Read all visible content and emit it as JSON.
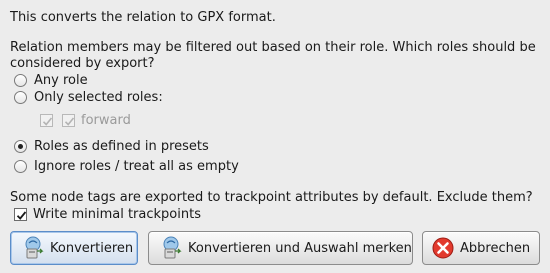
{
  "intro": "This converts the relation to GPX format.",
  "roles_question_line1": "Relation members may be filtered out based on their role. Which roles should be",
  "roles_question_line2": "considered by export?",
  "options": {
    "any_role": "Any role",
    "only_selected": "Only selected roles:",
    "forward": "forward",
    "presets": "Roles as defined in presets",
    "ignore": "Ignore roles / treat all as empty"
  },
  "selected_option": "presets",
  "node_tags_question": "Some node tags are exported to trackpoint attributes by default. Exclude them?",
  "write_minimal": "Write minimal trackpoints",
  "write_minimal_checked": true,
  "buttons": {
    "convert": "Konvertieren",
    "convert_remember": "Konvertieren und Auswahl merken",
    "cancel": "Abbrechen"
  }
}
